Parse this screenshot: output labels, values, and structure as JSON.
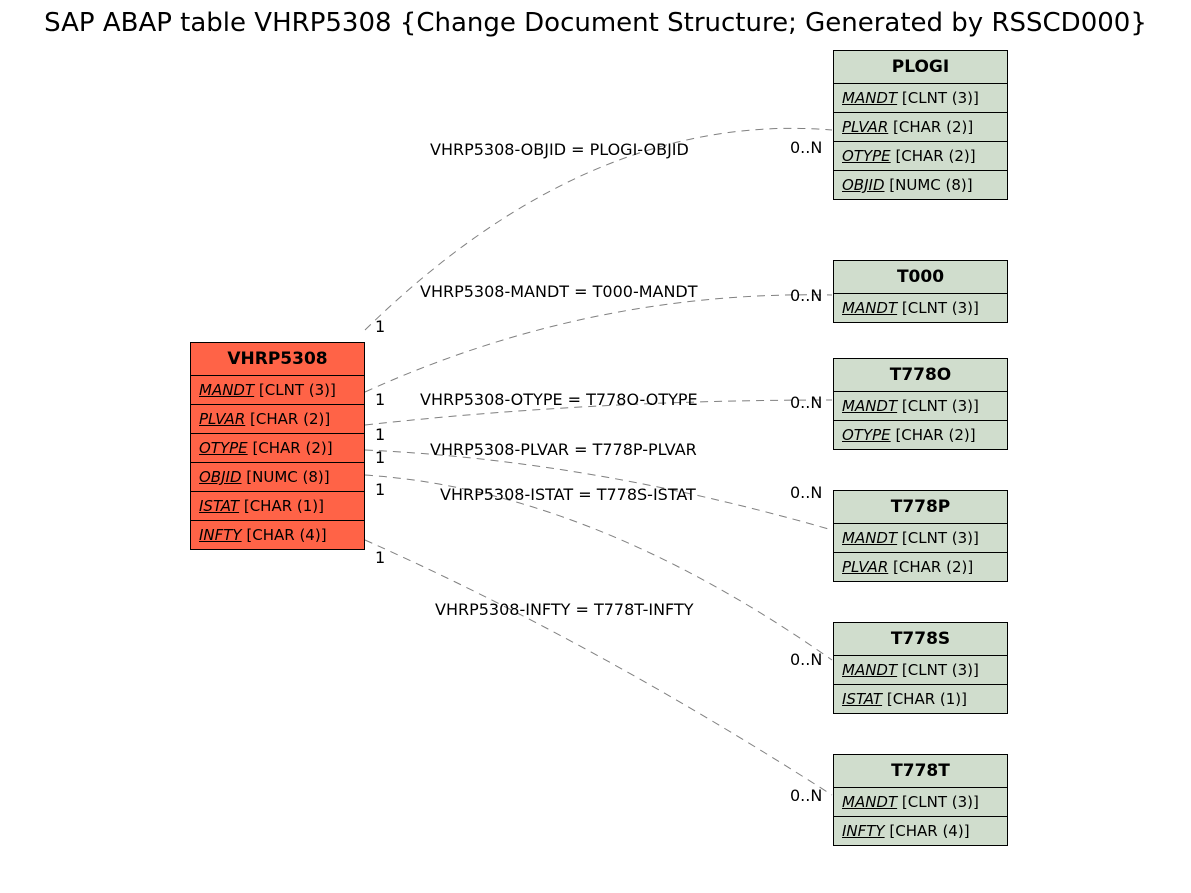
{
  "title": "SAP ABAP table VHRP5308 {Change Document Structure; Generated by RSSCD000}",
  "main": {
    "name": "VHRP5308",
    "fields": [
      {
        "name": "MANDT",
        "type": "[CLNT (3)]"
      },
      {
        "name": "PLVAR",
        "type": "[CHAR (2)]"
      },
      {
        "name": "OTYPE",
        "type": "[CHAR (2)]"
      },
      {
        "name": "OBJID",
        "type": "[NUMC (8)]"
      },
      {
        "name": "ISTAT",
        "type": "[CHAR (1)]"
      },
      {
        "name": "INFTY",
        "type": "[CHAR (4)]"
      }
    ]
  },
  "related": [
    {
      "name": "PLOGI",
      "fields": [
        {
          "name": "MANDT",
          "type": "[CLNT (3)]"
        },
        {
          "name": "PLVAR",
          "type": "[CHAR (2)]"
        },
        {
          "name": "OTYPE",
          "type": "[CHAR (2)]"
        },
        {
          "name": "OBJID",
          "type": "[NUMC (8)]"
        }
      ]
    },
    {
      "name": "T000",
      "fields": [
        {
          "name": "MANDT",
          "type": "[CLNT (3)]"
        }
      ]
    },
    {
      "name": "T778O",
      "fields": [
        {
          "name": "MANDT",
          "type": "[CLNT (3)]"
        },
        {
          "name": "OTYPE",
          "type": "[CHAR (2)]"
        }
      ]
    },
    {
      "name": "T778P",
      "fields": [
        {
          "name": "MANDT",
          "type": "[CLNT (3)]"
        },
        {
          "name": "PLVAR",
          "type": "[CHAR (2)]"
        }
      ]
    },
    {
      "name": "T778S",
      "fields": [
        {
          "name": "MANDT",
          "type": "[CLNT (3)]"
        },
        {
          "name": "ISTAT",
          "type": "[CHAR (1)]"
        }
      ]
    },
    {
      "name": "T778T",
      "fields": [
        {
          "name": "MANDT",
          "type": "[CLNT (3)]"
        },
        {
          "name": "INFTY",
          "type": "[CHAR (4)]"
        }
      ]
    }
  ],
  "edges": [
    {
      "label": "VHRP5308-OBJID = PLOGI-OBJID",
      "left": "1",
      "right": "0..N"
    },
    {
      "label": "VHRP5308-MANDT = T000-MANDT",
      "left": "1",
      "right": "0..N"
    },
    {
      "label": "VHRP5308-OTYPE = T778O-OTYPE",
      "left": "1",
      "right": "0..N"
    },
    {
      "label": "VHRP5308-PLVAR = T778P-PLVAR",
      "left": "1",
      "right": "0..N"
    },
    {
      "label": "VHRP5308-ISTAT = T778S-ISTAT",
      "left": "1",
      "right": "0..N"
    },
    {
      "label": "VHRP5308-INFTY = T778T-INFTY",
      "left": "1",
      "right": "0..N"
    }
  ]
}
